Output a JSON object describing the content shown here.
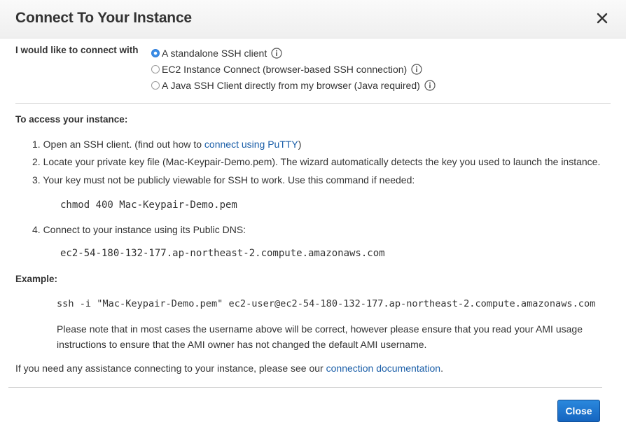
{
  "dialog": {
    "title": "Connect To Your Instance",
    "close_icon": "close-icon",
    "connect_label": "I would like to connect with",
    "options": [
      {
        "label": "A standalone SSH client",
        "selected": true
      },
      {
        "label": "EC2 Instance Connect (browser-based SSH connection)",
        "selected": false
      },
      {
        "label": "A Java SSH Client directly from my browser (Java required)",
        "selected": false
      }
    ],
    "access_heading": "To access your instance:",
    "steps": {
      "s1_prefix": "1. Open an SSH client. (find out how to ",
      "s1_link": "connect using PuTTY",
      "s1_suffix": ")",
      "s2": "2. Locate your private key file (Mac-Keypair-Demo.pem). The wizard automatically detects the key you used to launch the instance.",
      "s3": "3. Your key must not be publicly viewable for SSH to work. Use this command if needed:",
      "s3_command": "chmod 400 Mac-Keypair-Demo.pem",
      "s4": "4. Connect to your instance using its Public DNS:",
      "s4_dns": "ec2-54-180-132-177.ap-northeast-2.compute.amazonaws.com"
    },
    "example_heading": "Example:",
    "example_command": "ssh -i \"Mac-Keypair-Demo.pem\" ec2-user@ec2-54-180-132-177.ap-northeast-2.compute.amazonaws.com",
    "note": "Please note that in most cases the username above will be correct, however please ensure that you read your AMI usage instructions to ensure that the AMI owner has not changed the default AMI username.",
    "assist_prefix": "If you need any assistance connecting to your instance, please see our ",
    "assist_link": "connection documentation",
    "assist_suffix": ".",
    "close_button": "Close"
  }
}
